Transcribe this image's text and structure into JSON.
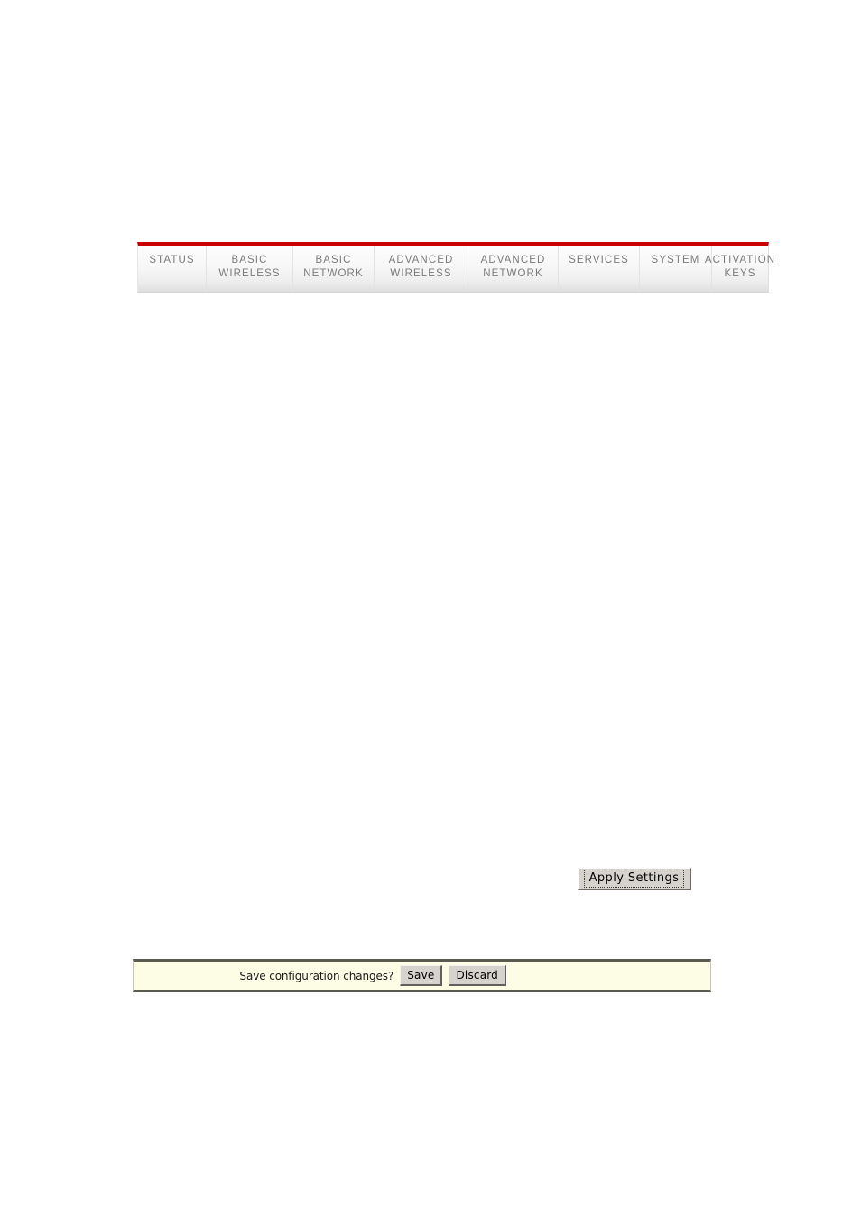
{
  "nav": {
    "accent_color": "#cc0000",
    "tabs": [
      {
        "label": "STATUS",
        "name": "status",
        "selected": false
      },
      {
        "label": "BASIC\nWIRELESS",
        "name": "basic-wireless",
        "selected": false
      },
      {
        "label": "BASIC\nNETWORK",
        "name": "basic-network",
        "selected": false
      },
      {
        "label": "ADVANCED\nWIRELESS",
        "name": "advanced-wireless",
        "selected": false
      },
      {
        "label": "ADVANCED\nNETWORK",
        "name": "advanced-network",
        "selected": false
      },
      {
        "label": "SERVICES",
        "name": "services",
        "selected": false
      },
      {
        "label": "SYSTEM",
        "name": "system",
        "selected": false
      },
      {
        "label": "ACTIVATION\nKEYS",
        "name": "activation-keys",
        "selected": false
      }
    ]
  },
  "main": {
    "apply_button_label": "Apply Settings"
  },
  "save_bar": {
    "prompt": "Save configuration changes?",
    "save_label": "Save",
    "discard_label": "Discard",
    "background_color": "#fdfce4",
    "border_color": "#5b5b52"
  }
}
